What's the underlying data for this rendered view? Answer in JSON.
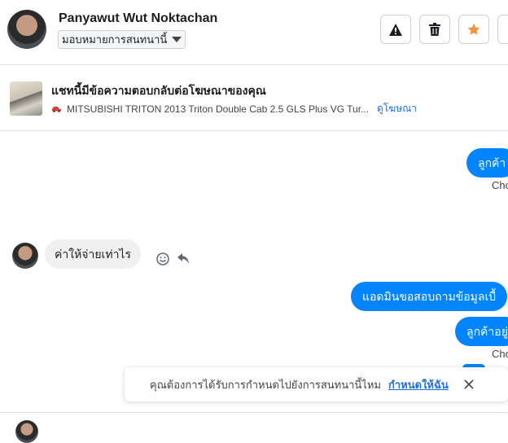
{
  "header": {
    "contact_name": "Panyawut Wut Noktachan",
    "assign_label": "มอบหมายการสนทนานี้",
    "buttons": [
      {
        "icon": "warning-icon"
      },
      {
        "icon": "trash-icon"
      },
      {
        "icon": "star-icon",
        "color": "#f7923b"
      },
      {
        "icon": "more-icon"
      }
    ]
  },
  "ad": {
    "title": "แชทนี้มีข้อความตอบกลับต่อโฆษณาของคุณ",
    "product": "MITSUBISHI TRITON 2013 Triton Double Cab 2.5 GLS Plus VG Tur...",
    "link": "ดูโฆษณา"
  },
  "messages": {
    "out1": {
      "text": "ลูกค้า",
      "meta": "Cho"
    },
    "in1": {
      "text": "ค่าให้จ่ายเท่าไร"
    },
    "out2": {
      "text": "แอดมินขอสอบถามข้อมูลเบื้"
    },
    "out3": {
      "text": "ลูกค้าอยู่",
      "meta": "Cho"
    }
  },
  "toast": {
    "text": "คุณต้องการได้รับการกำหนดไปยังการสนทนานี้ไหม",
    "link": "กำหนดให้ฉัน"
  },
  "colors": {
    "accent": "#0084ff",
    "link": "#216fdb",
    "star": "#f7923b"
  }
}
